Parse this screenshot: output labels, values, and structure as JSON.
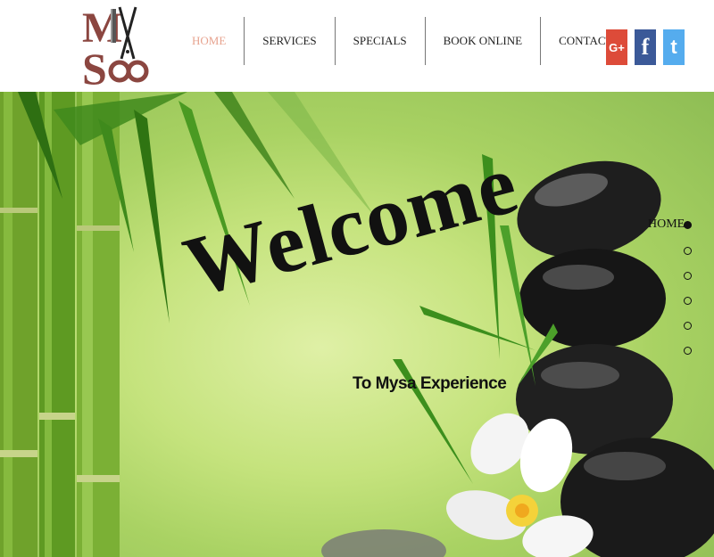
{
  "logo": {
    "letter_m": "M",
    "letter_s": "S"
  },
  "nav": {
    "items": [
      {
        "label": "HOME",
        "active": true
      },
      {
        "label": "SERVICES",
        "active": false
      },
      {
        "label": "SPECIALS",
        "active": false
      },
      {
        "label": "BOOK ONLINE",
        "active": false
      },
      {
        "label": "CONTACT",
        "active": false
      }
    ]
  },
  "social": {
    "google": {
      "glyph": "G+",
      "color": "#dd4b39"
    },
    "facebook": {
      "glyph": "f",
      "color": "#3b5998"
    },
    "twitter": {
      "glyph": "t",
      "color": "#55acee"
    }
  },
  "hero": {
    "title": "Welcome",
    "subtitle": "To Mysa Experience"
  },
  "section_nav": {
    "current_label": "HOME",
    "dot_count": 6,
    "active_index": 0
  },
  "colors": {
    "accent": "#e7a38f",
    "logo_brown": "#8b4640"
  }
}
